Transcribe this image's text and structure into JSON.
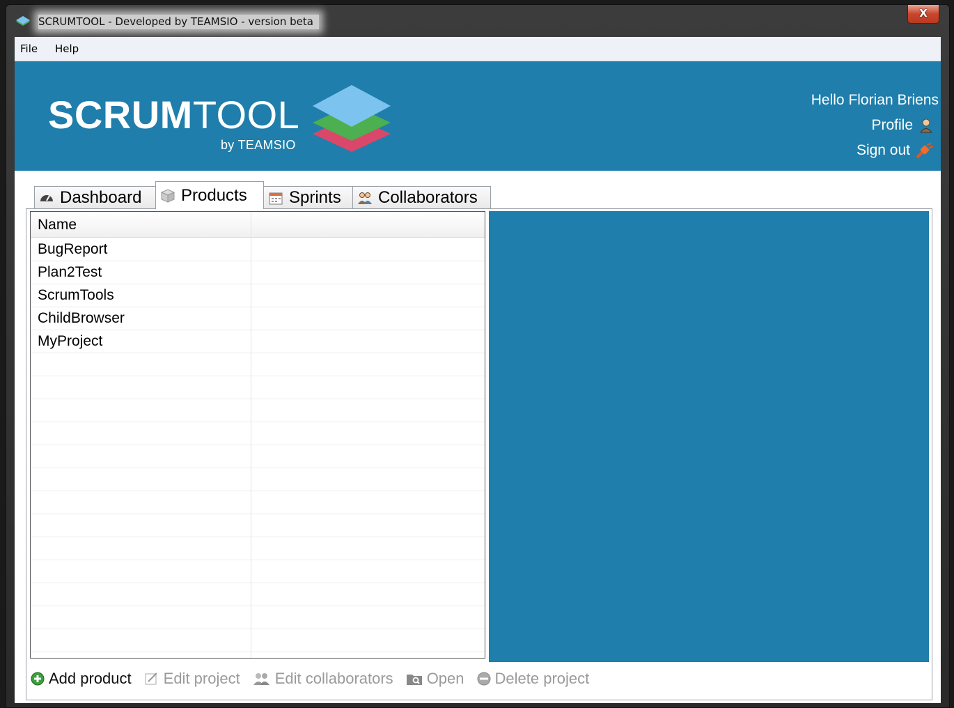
{
  "window": {
    "title": "SCRUMTOOL - Developed by TEAMSIO - version beta",
    "close_label": "X"
  },
  "menu": [
    "File",
    "Help"
  ],
  "banner": {
    "logo_bold": "SCRUM",
    "logo_light": "TOOL",
    "logo_sub": "by TEAMSIO",
    "greeting": "Hello Florian Briens",
    "profile_label": "Profile",
    "signout_label": "Sign out"
  },
  "tabs": [
    {
      "label": "Dashboard",
      "icon": "gauge-icon"
    },
    {
      "label": "Products",
      "icon": "box-icon",
      "active": true
    },
    {
      "label": "Sprints",
      "icon": "calendar-icon"
    },
    {
      "label": "Collaborators",
      "icon": "people-icon"
    }
  ],
  "products_table": {
    "columns": [
      "Name",
      ""
    ],
    "rows": [
      "BugReport",
      "Plan2Test",
      "ScrumTools",
      "ChildBrowser",
      "MyProject"
    ]
  },
  "toolbar": {
    "add_product": "Add product",
    "edit_project": "Edit project",
    "edit_collaborators": "Edit collaborators",
    "open": "Open",
    "delete_project": "Delete project"
  },
  "colors": {
    "brand_blue": "#1f7eab",
    "layer_blue": "#7cc3f0",
    "layer_green": "#4caf50",
    "layer_red": "#d9486a"
  }
}
